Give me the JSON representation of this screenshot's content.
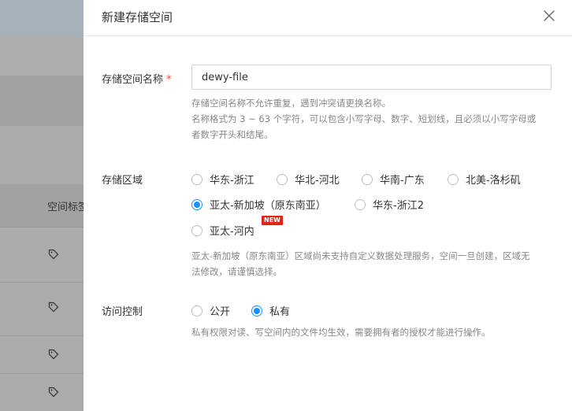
{
  "background": {
    "column_header": "空间标签",
    "row_icon": "tag-icon"
  },
  "drawer": {
    "title": "新建存储空间",
    "close_icon": "close-icon"
  },
  "form": {
    "name": {
      "label": "存储空间名称",
      "required_mark": "*",
      "value": "dewy-file",
      "help_line1": "存储空间名称不允许重复，遇到冲突请更换名称。",
      "help_line2": "名称格式为 3 ~ 63 个字符，可以包含小写字母、数字、短划线，且必须以小写字母或",
      "help_line3": "者数字开头和结尾。"
    },
    "region": {
      "label": "存储区域",
      "options": [
        {
          "label": "华东-浙江",
          "selected": false
        },
        {
          "label": "华北-河北",
          "selected": false
        },
        {
          "label": "华南-广东",
          "selected": false
        },
        {
          "label": "北美-洛杉矶",
          "selected": false
        },
        {
          "label": "亚太-新加坡（原东南亚）",
          "selected": true
        },
        {
          "label": "华东-浙江2",
          "selected": false
        },
        {
          "label": "亚太-河内",
          "selected": false
        }
      ],
      "new_badge": "NEW",
      "help_line1": "亚太-新加坡（原东南亚）区域尚未支持自定义数据处理服务，空间一旦创建，区域无",
      "help_line2": "法修改，请谨慎选择。"
    },
    "access": {
      "label": "访问控制",
      "options": [
        {
          "label": "公开",
          "selected": false
        },
        {
          "label": "私有",
          "selected": true
        }
      ],
      "help": "私有权限对读、写空间内的文件均生效，需要拥有者的授权才能进行操作。"
    }
  },
  "colors": {
    "primary": "#1890ff",
    "required": "#e74c3c",
    "badge": "#e2231a",
    "overlay": "#a2a2a2"
  }
}
